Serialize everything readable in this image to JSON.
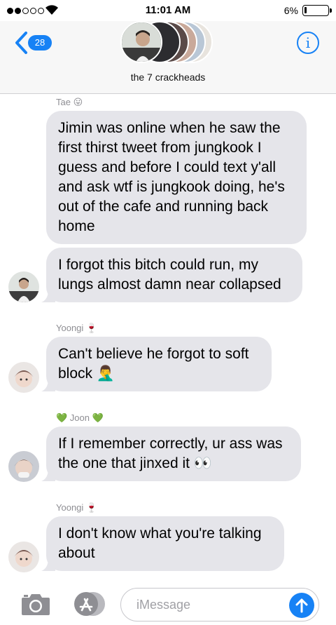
{
  "status_bar": {
    "time": "11:01 AM",
    "battery_percent": "6%"
  },
  "header": {
    "back_badge": "28",
    "group_name": "the 7 crackheads",
    "info_label": "i"
  },
  "messages": [
    {
      "sender": "Tae 😛",
      "text": "Jimin was online when he saw the first thirst tweet from jungkook I guess and before I could text y'all and ask wtf is jungkook doing, he's out of the cafe and running back home"
    },
    {
      "text": "I forgot this bitch could run, my lungs almost damn near collapsed"
    },
    {
      "sender": "Yoongi 🍷",
      "text": "Can't believe he forgot to soft block 🤦‍♂️"
    },
    {
      "sender": "💚 Joon 💚",
      "text": "If I remember correctly, ur ass was the one that jinxed it 👀"
    },
    {
      "sender": "Yoongi 🍷",
      "text": "I don't know what you're talking about"
    }
  ],
  "input": {
    "placeholder": "iMessage"
  },
  "colors": {
    "accent": "#1782f5",
    "bubble": "#e5e5ea",
    "sender_gray": "#8e8e93"
  }
}
